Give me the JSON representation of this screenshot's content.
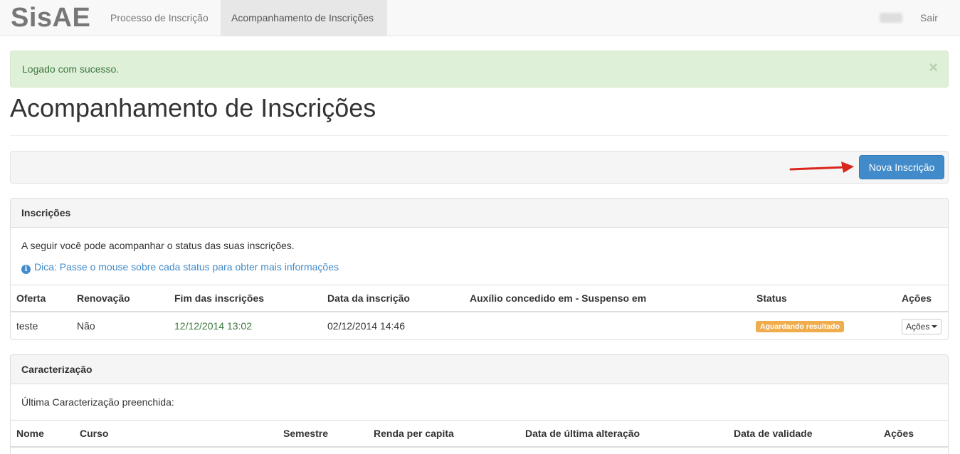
{
  "navbar": {
    "brand": "SisAE",
    "links": [
      {
        "label": "Processo de Inscrição",
        "active": false
      },
      {
        "label": "Acompanhamento de Inscrições",
        "active": true
      }
    ],
    "logout_label": "Sair"
  },
  "alert": {
    "message": "Logado com sucesso.",
    "close_glyph": "×",
    "color": "#3c763d",
    "background": "#dff0d8"
  },
  "page": {
    "title": "Acompanhamento de Inscrições"
  },
  "toolbar": {
    "new_button_label": "Nova Inscrição",
    "button_color": "#428bca",
    "annotation": "red-arrow-icon"
  },
  "inscricoes": {
    "heading": "Inscrições",
    "description": "A seguir você pode acompanhar o status das suas inscrições.",
    "tip": "Dica: Passe o mouse sobre cada status para obter mais informações",
    "tip_icon": "info-icon",
    "columns": [
      "Oferta",
      "Renovação",
      "Fim das inscrições",
      "Data da inscrição",
      "Auxílio concedido em - Suspenso em",
      "Status",
      "Ações"
    ],
    "rows": [
      {
        "oferta": "teste",
        "renovacao": "Não",
        "fim_inscricoes": "12/12/2014 13:02",
        "data_inscricao": "02/12/2014 14:46",
        "auxilio": "",
        "status": "Aguardando resultado",
        "status_color": "#f0ad4e",
        "acoes_label": "Ações"
      }
    ]
  },
  "caracterizacao": {
    "heading": "Caracterização",
    "description": "Última Caracterização preenchida:",
    "columns": [
      "Nome",
      "Curso",
      "Semestre",
      "Renda per capita",
      "Data de última alteração",
      "Data de validade",
      "Ações"
    ]
  }
}
